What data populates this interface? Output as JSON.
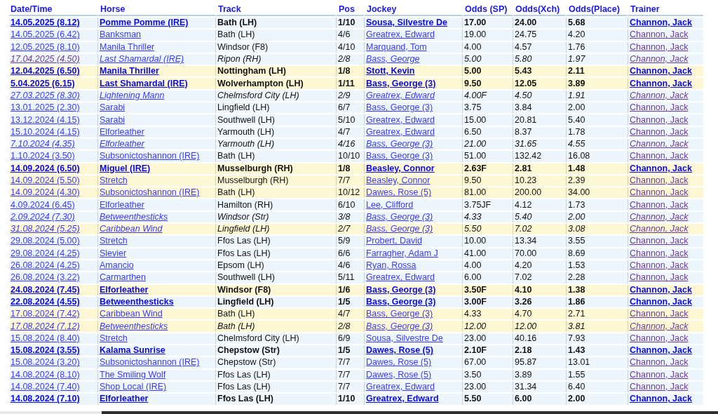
{
  "table": {
    "columns": [
      "Date/Time",
      "Horse",
      "Track",
      "Pos",
      "Jockey",
      "Odds (SP)",
      "Odds(Xch)",
      "Odds(Place)",
      "Trainer"
    ],
    "rows": [
      {
        "date": "14.05.2025 (8.12)",
        "horse": "Pomme Pomme (IRE)",
        "track": "Bath (LH)",
        "pos": "1/10",
        "jockey": "Sousa, Silvestre De",
        "sp": "17.00",
        "xch": "24.00",
        "place": "5.68",
        "trainer": "Channon, Jack",
        "won": true,
        "italic": false,
        "highlighted": false,
        "date_visited": false
      },
      {
        "date": "14.05.2025 (6.42)",
        "horse": "Banksman",
        "track": "Bath (LH)",
        "pos": "4/6",
        "jockey": "Greatrex, Edward",
        "sp": "19.00",
        "xch": "24.75",
        "place": "4.20",
        "trainer": "Channon, Jack",
        "won": false,
        "italic": false,
        "highlighted": false,
        "date_visited": false
      },
      {
        "date": "12.05.2025 (8.10)",
        "horse": "Manila Thriller",
        "track": "Windsor (F8)",
        "pos": "4/10",
        "jockey": "Marquand, Tom",
        "sp": "4.00",
        "xch": "4.57",
        "place": "1.76",
        "trainer": "Channon, Jack",
        "won": false,
        "italic": false,
        "highlighted": false,
        "date_visited": false
      },
      {
        "date": "17.04.2025 (4.50)",
        "horse": "Last Shamardal (IRE)",
        "track": "Ripon (RH)",
        "pos": "2/8",
        "jockey": "Bass, George",
        "sp": "5.00",
        "xch": "5.80",
        "place": "1.97",
        "trainer": "Channon, Jack",
        "won": false,
        "italic": true,
        "highlighted": false,
        "date_visited": true
      },
      {
        "date": "12.04.2025 (6.50)",
        "horse": "Manila Thriller",
        "track": "Nottingham (LH)",
        "pos": "1/8",
        "jockey": "Stott, Kevin",
        "sp": "5.00",
        "xch": "5.43",
        "place": "2.11",
        "trainer": "Channon, Jack",
        "won": true,
        "italic": false,
        "highlighted": true,
        "date_visited": false
      },
      {
        "date": "5.04.2025 (6.15)",
        "horse": "Last Shamardal (IRE)",
        "track": "Wolverhampton (LH)",
        "pos": "1/11",
        "jockey": "Bass, George (3)",
        "sp": "9.50",
        "xch": "12.05",
        "place": "3.89",
        "trainer": "Channon, Jack",
        "won": true,
        "italic": false,
        "highlighted": true,
        "date_visited": false
      },
      {
        "date": "27.03.2025 (8.30)",
        "horse": "Lightening Mann",
        "track": "Chelmsford City (LH)",
        "pos": "2/9",
        "jockey": "Greatrex, Edward",
        "sp": "4.00F",
        "xch": "4.50",
        "place": "1.91",
        "trainer": "Channon, Jack",
        "won": false,
        "italic": true,
        "highlighted": false,
        "date_visited": false
      },
      {
        "date": "13.01.2025 (2.30)",
        "horse": "Sarabi",
        "track": "Lingfield (LH)",
        "pos": "6/7",
        "jockey": "Bass, George (3)",
        "sp": "3.75",
        "xch": "3.84",
        "place": "2.00",
        "trainer": "Channon, Jack",
        "won": false,
        "italic": false,
        "highlighted": false,
        "date_visited": false
      },
      {
        "date": "13.12.2024 (4.15)",
        "horse": "Sarabi",
        "track": "Southwell (LH)",
        "pos": "5/10",
        "jockey": "Greatrex, Edward",
        "sp": "15.00",
        "xch": "20.81",
        "place": "5.40",
        "trainer": "Channon, Jack",
        "won": false,
        "italic": false,
        "highlighted": false,
        "date_visited": false
      },
      {
        "date": "15.10.2024 (4.15)",
        "horse": "Elforleather",
        "track": "Yarmouth (LH)",
        "pos": "4/7",
        "jockey": "Greatrex, Edward",
        "sp": "6.50",
        "xch": "8.37",
        "place": "1.78",
        "trainer": "Channon, Jack",
        "won": false,
        "italic": false,
        "highlighted": false,
        "date_visited": false
      },
      {
        "date": "7.10.2024 (4.35)",
        "horse": "Elforleather",
        "track": "Yarmouth (LH)",
        "pos": "4/16",
        "jockey": "Bass, George (3)",
        "sp": "21.00",
        "xch": "31.65",
        "place": "4.55",
        "trainer": "Channon, Jack",
        "won": false,
        "italic": true,
        "highlighted": false,
        "date_visited": false
      },
      {
        "date": "1.10.2024 (3.50)",
        "horse": "Subsonictoshannon (IRE)",
        "track": "Bath (LH)",
        "pos": "10/10",
        "jockey": "Bass, George (3)",
        "sp": "51.00",
        "xch": "132.42",
        "place": "16.08",
        "trainer": "Channon, Jack",
        "won": false,
        "italic": false,
        "highlighted": false,
        "date_visited": false
      },
      {
        "date": "14.09.2024 (6.50)",
        "horse": "Miguel (IRE)",
        "track": "Musselburgh (RH)",
        "pos": "1/8",
        "jockey": "Beasley, Connor",
        "sp": "2.63F",
        "xch": "2.81",
        "place": "1.48",
        "trainer": "Channon, Jack",
        "won": true,
        "italic": false,
        "highlighted": true,
        "date_visited": false
      },
      {
        "date": "14.09.2024 (5.50)",
        "horse": "Stretch",
        "track": "Musselburgh (RH)",
        "pos": "7/7",
        "jockey": "Beasley, Connor",
        "sp": "9.50",
        "xch": "10.23",
        "place": "2.39",
        "trainer": "Channon, Jack",
        "won": false,
        "italic": false,
        "highlighted": true,
        "date_visited": false
      },
      {
        "date": "14.09.2024 (4.30)",
        "horse": "Subsonictoshannon (IRE)",
        "track": "Bath (LH)",
        "pos": "10/12",
        "jockey": "Dawes, Rose (5)",
        "sp": "81.00",
        "xch": "200.00",
        "place": "34.00",
        "trainer": "Channon, Jack",
        "won": false,
        "italic": false,
        "highlighted": true,
        "date_visited": false
      },
      {
        "date": "4.09.2024 (6.45)",
        "horse": "Elforleather",
        "track": "Hamilton (RH)",
        "pos": "6/10",
        "jockey": "Lee, Clifford",
        "sp": "3.75JF",
        "xch": "4.12",
        "place": "1.73",
        "trainer": "Channon, Jack",
        "won": false,
        "italic": false,
        "highlighted": false,
        "date_visited": false
      },
      {
        "date": "2.09.2024 (7.30)",
        "horse": "Betweenthesticks",
        "track": "Windsor (Str)",
        "pos": "3/8",
        "jockey": "Bass, George (3)",
        "sp": "4.33",
        "xch": "5.40",
        "place": "2.00",
        "trainer": "Channon, Jack",
        "won": false,
        "italic": true,
        "highlighted": false,
        "date_visited": false
      },
      {
        "date": "31.08.2024 (5.25)",
        "horse": "Caribbean Wind",
        "track": "Lingfield (LH)",
        "pos": "2/7",
        "jockey": "Bass, George (3)",
        "sp": "5.50",
        "xch": "7.02",
        "place": "3.08",
        "trainer": "Channon, Jack",
        "won": false,
        "italic": true,
        "highlighted": true,
        "date_visited": false
      },
      {
        "date": "29.08.2024 (5.00)",
        "horse": "Stretch",
        "track": "Ffos Las (LH)",
        "pos": "5/9",
        "jockey": "Probert, David",
        "sp": "10.00",
        "xch": "13.34",
        "place": "3.55",
        "trainer": "Channon, Jack",
        "won": false,
        "italic": false,
        "highlighted": false,
        "date_visited": false
      },
      {
        "date": "29.08.2024 (4.25)",
        "horse": "Slevier",
        "track": "Ffos Las (LH)",
        "pos": "6/6",
        "jockey": "Farragher, Adam J",
        "sp": "41.00",
        "xch": "70.00",
        "place": "8.69",
        "trainer": "Channon, Jack",
        "won": false,
        "italic": false,
        "highlighted": false,
        "date_visited": false
      },
      {
        "date": "26.08.2024 (4.25)",
        "horse": "Amancio",
        "track": "Epsom (LH)",
        "pos": "4/6",
        "jockey": "Ryan, Rossa",
        "sp": "4.00",
        "xch": "4.20",
        "place": "1.53",
        "trainer": "Channon, Jack",
        "won": false,
        "italic": false,
        "highlighted": false,
        "date_visited": false
      },
      {
        "date": "26.08.2024 (3.22)",
        "horse": "Carmarthen",
        "track": "Southwell (LH)",
        "pos": "5/11",
        "jockey": "Greatrex, Edward",
        "sp": "6.00",
        "xch": "7.02",
        "place": "2.28",
        "trainer": "Channon, Jack",
        "won": false,
        "italic": false,
        "highlighted": false,
        "date_visited": false
      },
      {
        "date": "24.08.2024 (7.45)",
        "horse": "Elforleather",
        "track": "Windsor (F8)",
        "pos": "1/6",
        "jockey": "Bass, George (3)",
        "sp": "3.50F",
        "xch": "4.10",
        "place": "1.38",
        "trainer": "Channon, Jack",
        "won": true,
        "italic": false,
        "highlighted": true,
        "date_visited": false
      },
      {
        "date": "22.08.2024 (4.55)",
        "horse": "Betweenthesticks",
        "track": "Lingfield (LH)",
        "pos": "1/5",
        "jockey": "Bass, George (3)",
        "sp": "3.00F",
        "xch": "3.26",
        "place": "1.86",
        "trainer": "Channon, Jack",
        "won": true,
        "italic": false,
        "highlighted": false,
        "date_visited": false
      },
      {
        "date": "17.08.2024 (7.42)",
        "horse": "Caribbean Wind",
        "track": "Bath (LH)",
        "pos": "4/7",
        "jockey": "Bass, George (3)",
        "sp": "4.33",
        "xch": "4.70",
        "place": "2.71",
        "trainer": "Channon, Jack",
        "won": false,
        "italic": false,
        "highlighted": true,
        "date_visited": false
      },
      {
        "date": "17.08.2024 (7.12)",
        "horse": "Betweenthesticks",
        "track": "Bath (LH)",
        "pos": "2/8",
        "jockey": "Bass, George (3)",
        "sp": "12.00",
        "xch": "12.00",
        "place": "3.81",
        "trainer": "Channon, Jack",
        "won": false,
        "italic": true,
        "highlighted": true,
        "date_visited": false
      },
      {
        "date": "15.08.2024 (8.40)",
        "horse": "Stretch",
        "track": "Chelmsford City (LH)",
        "pos": "6/9",
        "jockey": "Sousa, Silvestre De",
        "sp": "23.00",
        "xch": "40.16",
        "place": "7.93",
        "trainer": "Channon, Jack",
        "won": false,
        "italic": false,
        "highlighted": false,
        "date_visited": false
      },
      {
        "date": "15.08.2024 (3.55)",
        "horse": "Kalama Sunrise",
        "track": "Chepstow (Str)",
        "pos": "1/5",
        "jockey": "Dawes, Rose (5)",
        "sp": "2.10F",
        "xch": "2.18",
        "place": "1.43",
        "trainer": "Channon, Jack",
        "won": true,
        "italic": false,
        "highlighted": false,
        "date_visited": false
      },
      {
        "date": "15.08.2024 (3.20)",
        "horse": "Subsonictoshannon (IRE)",
        "track": "Chepstow (Str)",
        "pos": "7/7",
        "jockey": "Dawes, Rose (5)",
        "sp": "67.00",
        "xch": "95.87",
        "place": "13.01",
        "trainer": "Channon, Jack",
        "won": false,
        "italic": false,
        "highlighted": false,
        "date_visited": false
      },
      {
        "date": "14.08.2024 (8.10)",
        "horse": "The Smiling Wolf",
        "track": "Ffos Las (LH)",
        "pos": "7/7",
        "jockey": "Dawes, Rose (5)",
        "sp": "3.50",
        "xch": "3.89",
        "place": "1.55",
        "trainer": "Channon, Jack",
        "won": false,
        "italic": false,
        "highlighted": false,
        "date_visited": false
      },
      {
        "date": "14.08.2024 (7.40)",
        "horse": "Shop Local (IRE)",
        "track": "Ffos Las (LH)",
        "pos": "7/7",
        "jockey": "Greatrex, Edward",
        "sp": "23.00",
        "xch": "31.34",
        "place": "6.40",
        "trainer": "Channon, Jack",
        "won": false,
        "italic": false,
        "highlighted": false,
        "date_visited": false
      },
      {
        "date": "14.08.2024 (7.10)",
        "horse": "Elforleather",
        "track": "Ffos Las (LH)",
        "pos": "1/10",
        "jockey": "Greatrex, Edward",
        "sp": "5.50",
        "xch": "6.00",
        "place": "2.00",
        "trainer": "Channon, Jack",
        "won": true,
        "italic": false,
        "highlighted": false,
        "date_visited": false
      }
    ]
  }
}
